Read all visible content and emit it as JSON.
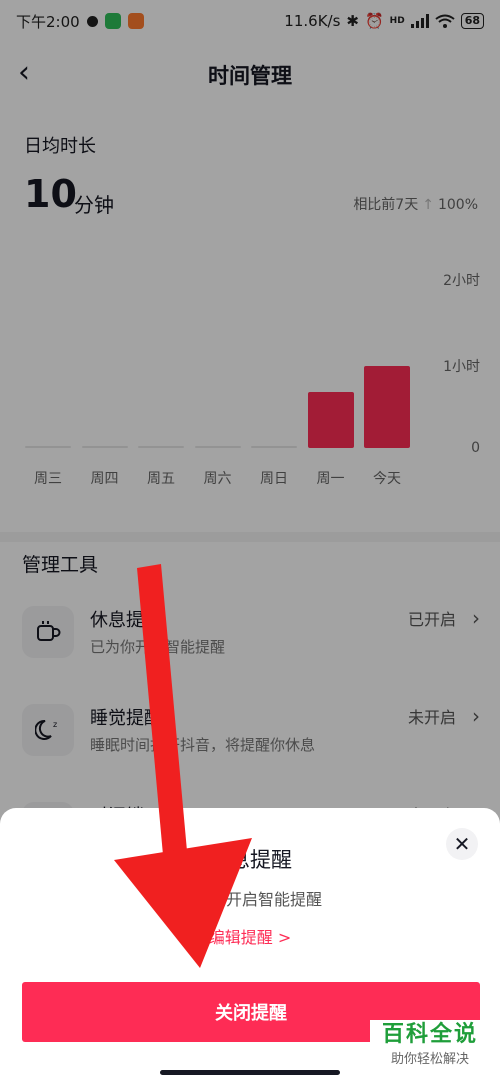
{
  "status_bar": {
    "time": "下午2:00",
    "network_speed": "11.6K/s",
    "signal_label": "HD",
    "battery": "68"
  },
  "nav": {
    "back_icon": "chevron-left-icon",
    "title": "时间管理"
  },
  "summary": {
    "label": "日均时长",
    "value": "10",
    "unit": "分钟",
    "compare_label": "相比前7天",
    "compare_value": "100%"
  },
  "chart_data": {
    "type": "bar",
    "categories": [
      "周三",
      "周四",
      "周五",
      "周六",
      "周日",
      "周一",
      "今天"
    ],
    "values": [
      0,
      0,
      0,
      0,
      0,
      40,
      58
    ],
    "ytick_labels": [
      "2小时",
      "1小时",
      "0"
    ],
    "ylim": [
      0,
      120
    ],
    "bar_color": "#fe2c55"
  },
  "tools": {
    "title": "管理工具",
    "items": [
      {
        "name": "休息提醒",
        "desc": "已为你开启智能提醒",
        "state": "已开启",
        "icon": "coffee-cup-icon"
      },
      {
        "name": "睡觉提醒",
        "desc": "睡眠时间打开抖音，将提醒你休息",
        "state": "未开启",
        "icon": "moon-sleep-icon"
      },
      {
        "name": "时间锁",
        "desc": "",
        "state": "未开启",
        "icon": "lock-icon"
      }
    ]
  },
  "sheet": {
    "title": "休息提醒",
    "desc": "已为你开启智能提醒",
    "link": "编辑提醒 >",
    "button": "关闭提醒",
    "close_icon": "close-icon"
  },
  "watermark": {
    "line1": "百科全说",
    "line2": "助你轻松解决"
  },
  "colors": {
    "accent": "#fe2c55",
    "arrow": "#f02020",
    "watermark": "#1f9e3a"
  }
}
